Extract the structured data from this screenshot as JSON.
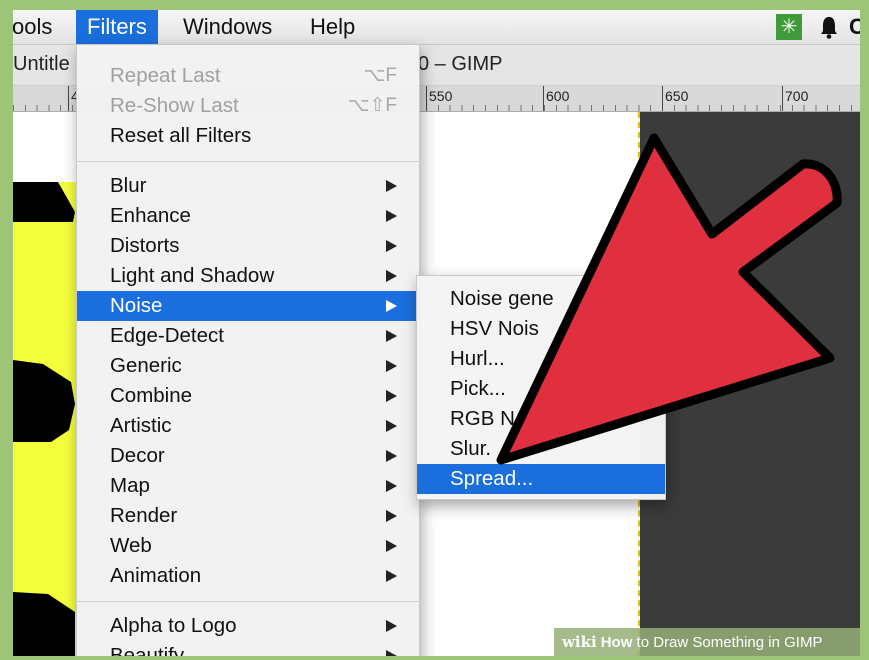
{
  "menubar": {
    "items": [
      "ools",
      "Filters",
      "Windows",
      "Help"
    ],
    "active": "Filters",
    "right_icons": [
      "extension-icon",
      "bell-icon",
      "clipped-icon"
    ],
    "clipped_right_text": "C"
  },
  "titlebar": {
    "left": "Untitle",
    "right": "0 – GIMP"
  },
  "ruler": {
    "labels": [
      "550",
      "600",
      "650",
      "700"
    ],
    "left_partial": "4"
  },
  "filters_menu": {
    "top_items": [
      {
        "label": "Repeat Last",
        "shortcut": "⌥F",
        "disabled": true
      },
      {
        "label": "Re-Show Last",
        "shortcut": "⌥⇧F",
        "disabled": true
      },
      {
        "label": "Reset all Filters",
        "disabled": false
      }
    ],
    "items": [
      {
        "label": "Blur"
      },
      {
        "label": "Enhance"
      },
      {
        "label": "Distorts"
      },
      {
        "label": "Light and Shadow"
      },
      {
        "label": "Noise",
        "highlighted": true
      },
      {
        "label": "Edge-Detect"
      },
      {
        "label": "Generic"
      },
      {
        "label": "Combine"
      },
      {
        "label": "Artistic"
      },
      {
        "label": "Decor"
      },
      {
        "label": "Map"
      },
      {
        "label": "Render"
      },
      {
        "label": "Web"
      },
      {
        "label": "Animation"
      }
    ],
    "bottom_items": [
      {
        "label": "Alpha to Logo"
      },
      {
        "label": "Beautify"
      }
    ]
  },
  "noise_submenu": {
    "items": [
      "Noise gene",
      "HSV Nois",
      "Hurl...",
      "Pick...",
      "RGB N",
      "Slur.",
      "Spread..."
    ],
    "highlighted": "Spread..."
  },
  "overlay": {
    "arrow_color": "#e0303f",
    "arrow_outline": "#000000"
  },
  "watermark": {
    "brand": "wiki",
    "brand_how": "How",
    "text": "to Draw Something in GIMP"
  },
  "colors": {
    "accent": "#1a6fdd",
    "canvas_yellow": "#f4ff3c",
    "canvas_dark": "#3b3b3b"
  }
}
